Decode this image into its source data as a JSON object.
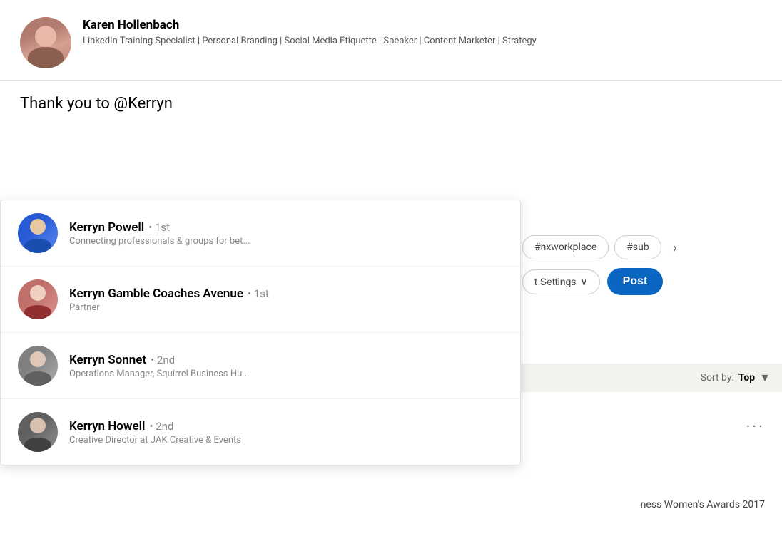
{
  "profile": {
    "name": "Karen Hollenbach",
    "headline": "LinkedIn Training Specialist | Personal Branding | Social Media Etiquette | Speaker | Content Marketer | Strategy"
  },
  "post": {
    "text": "Thank you to @Kerryn"
  },
  "suggestions": [
    {
      "id": "1",
      "name": "Kerryn Powell",
      "degree": "• 1st",
      "subtitle": "Connecting professionals & groups for bet...",
      "avatar_class": "sug-avatar-1"
    },
    {
      "id": "2",
      "name": "Kerryn Gamble Coaches Avenue",
      "degree": "• 1st",
      "subtitle": "Partner",
      "avatar_class": "sug-avatar-2"
    },
    {
      "id": "3",
      "name": "Kerryn Sonnet",
      "degree": "• 2nd",
      "subtitle": "Operations Manager, Squirrel Business Hu...",
      "avatar_class": "sug-avatar-3"
    },
    {
      "id": "4",
      "name": "Kerryn Howell",
      "degree": "• 2nd",
      "subtitle": "Creative Director at JAK Creative & Events",
      "avatar_class": "sug-avatar-4"
    }
  ],
  "hashtags": [
    {
      "label": "#nxworkplace"
    },
    {
      "label": "#sub"
    }
  ],
  "settings_btn": "t Settings",
  "post_btn": "Post",
  "sort": {
    "label": "Sort by:",
    "value": "Top"
  },
  "award_text": "ness Women's Awards 2017",
  "chevron_right": "›",
  "chevron_down": "∨",
  "dots": "..."
}
